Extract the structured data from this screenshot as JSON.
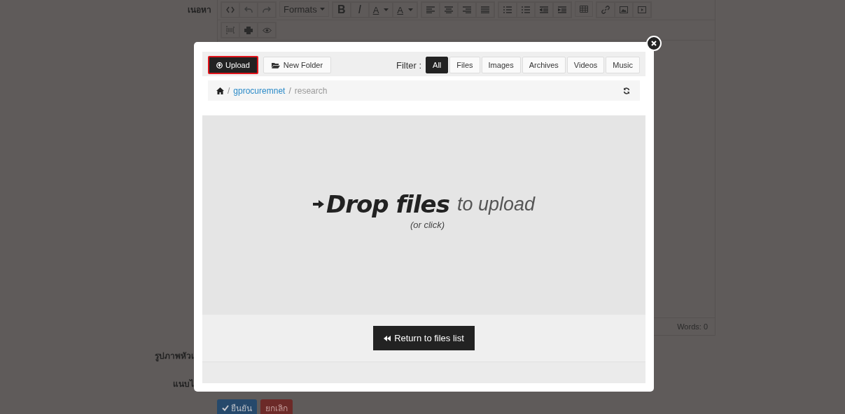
{
  "page": {
    "content_label": "เนอหา",
    "cover_image_label": "รูปภาพหัวเ",
    "attach_label": "แนบไ",
    "editor": {
      "formats_button": "Formats",
      "letter_buttons": [
        "B",
        "I",
        "A",
        "A"
      ],
      "word_count": "Words: 0"
    },
    "buttons": [
      {
        "label": "ยืนยัน",
        "kind": "confirm"
      },
      {
        "label": "ยกเลิก",
        "kind": "cancel"
      }
    ]
  },
  "dialog": {
    "upload_button": "Upload",
    "new_folder_button": "New Folder",
    "filter_label": "Filter :",
    "filters": [
      {
        "label": "All",
        "selected": true
      },
      {
        "label": "Files",
        "selected": false
      },
      {
        "label": "Images",
        "selected": false
      },
      {
        "label": "Archives",
        "selected": false
      },
      {
        "label": "Videos",
        "selected": false
      },
      {
        "label": "Music",
        "selected": false
      }
    ],
    "breadcrumb": [
      {
        "label": "gprocuremnet",
        "current": false
      },
      {
        "label": "research",
        "current": true
      }
    ],
    "breadcrumb_separator": "/",
    "drop_zone": {
      "title": "Drop files",
      "subtitle": "to upload",
      "hint": "(or click)"
    },
    "return_button": "Return to files list"
  }
}
